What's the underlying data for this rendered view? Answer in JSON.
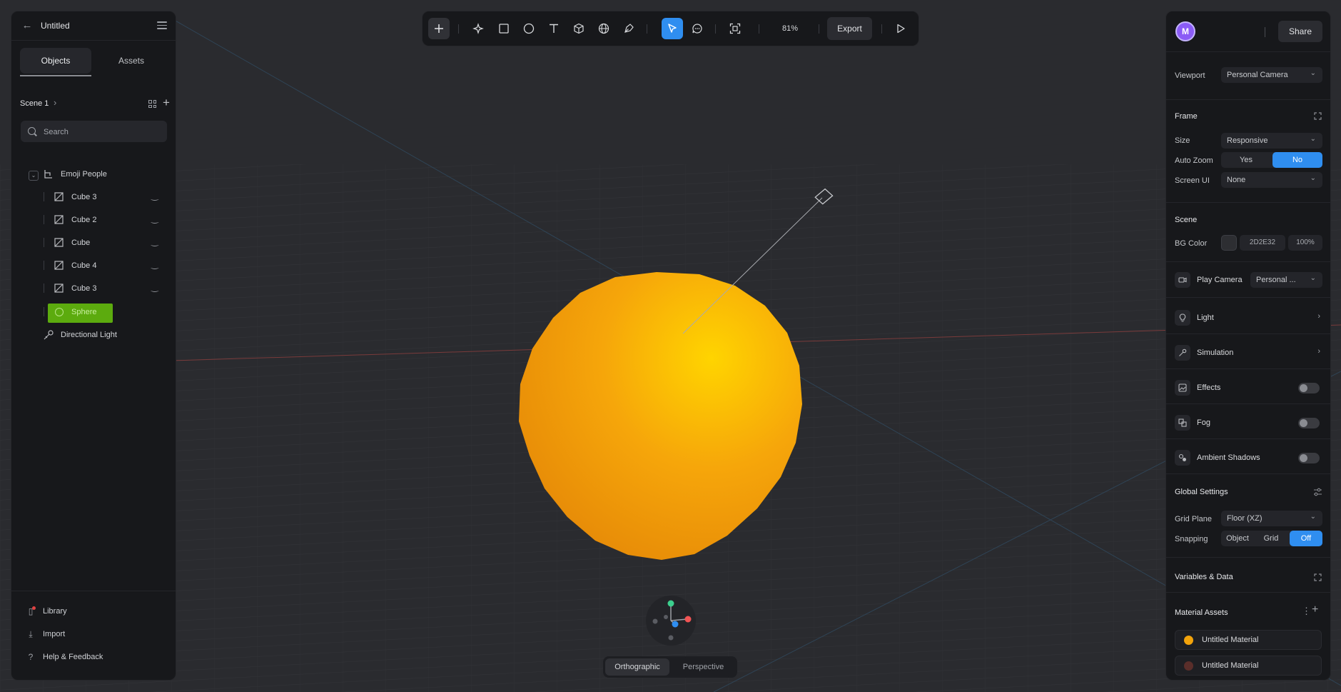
{
  "document": {
    "title": "Untitled"
  },
  "left_panel": {
    "tabs": [
      "Objects",
      "Assets"
    ],
    "scene_label": "Scene 1",
    "search_placeholder": "Search",
    "group_label": "Emoji People",
    "items": [
      "Cube 3",
      "Cube 2",
      "Cube",
      "Cube 4",
      "Cube 3"
    ],
    "selected_item": "Sphere",
    "light_label": "Directional Light",
    "footer": {
      "library": "Library",
      "import": "Import",
      "help": "Help & Feedback"
    }
  },
  "toolbar": {
    "zoom": "81%",
    "export_label": "Export"
  },
  "right_panel": {
    "avatar_initial": "M",
    "share_label": "Share",
    "viewport_label": "Viewport",
    "viewport_value": "Personal Camera",
    "frame_title": "Frame",
    "size_label": "Size",
    "size_value": "Responsive",
    "auto_zoom_label": "Auto Zoom",
    "auto_zoom_yes": "Yes",
    "auto_zoom_no": "No",
    "screen_ui_label": "Screen UI",
    "screen_ui_value": "None",
    "scene_title": "Scene",
    "bg_color_label": "BG Color",
    "bg_color_hex": "2D2E32",
    "bg_opacity": "100%",
    "play_camera_label": "Play Camera",
    "play_camera_value": "Personal ...",
    "light_label": "Light",
    "simulation_label": "Simulation",
    "effects_label": "Effects",
    "fog_label": "Fog",
    "ambient_shadows_label": "Ambient Shadows",
    "global_settings_title": "Global Settings",
    "grid_plane_label": "Grid Plane",
    "grid_plane_value": "Floor (XZ)",
    "snapping_label": "Snapping",
    "snapping_object": "Object",
    "snapping_grid": "Grid",
    "snapping_off": "Off",
    "variables_title": "Variables & Data",
    "material_assets_title": "Material Assets",
    "materials": [
      "Untitled Material",
      "Untitled Material"
    ]
  },
  "view_toggle": {
    "orthographic": "Orthographic",
    "perspective": "Perspective"
  },
  "colors": {
    "accent": "#2f8ef0",
    "selection": "#5cab0e",
    "sphere": "#f5a300",
    "bg": "#2D2E32",
    "material_1": "#f2a30b",
    "material_2": "#5a2e2a"
  }
}
